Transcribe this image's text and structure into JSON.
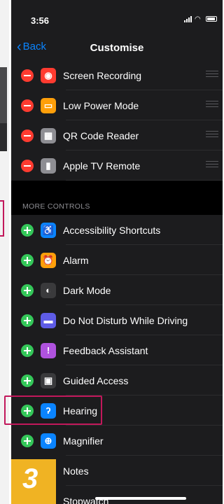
{
  "status_bar": {
    "time": "3:56"
  },
  "nav": {
    "back_label": "Back",
    "title": "Customise"
  },
  "included_controls": [
    {
      "label": "Screen Recording",
      "icon": "screen-recording-icon",
      "color": "#ff3b30"
    },
    {
      "label": "Low Power Mode",
      "icon": "battery-icon",
      "color": "#ff9f0a"
    },
    {
      "label": "QR Code Reader",
      "icon": "qr-code-icon",
      "color": "#8e8e93"
    },
    {
      "label": "Apple TV Remote",
      "icon": "remote-icon",
      "color": "#8e8e93"
    }
  ],
  "more_controls": {
    "header": "MORE CONTROLS",
    "items": [
      {
        "label": "Accessibility Shortcuts",
        "icon": "accessibility-icon",
        "color": "#0a84ff"
      },
      {
        "label": "Alarm",
        "icon": "alarm-icon",
        "color": "#ff9f0a"
      },
      {
        "label": "Dark Mode",
        "icon": "dark-mode-icon",
        "color": "#3a3a3c"
      },
      {
        "label": "Do Not Disturb While Driving",
        "icon": "car-icon",
        "color": "#5e5ce6"
      },
      {
        "label": "Feedback Assistant",
        "icon": "feedback-icon",
        "color": "#af52de"
      },
      {
        "label": "Guided Access",
        "icon": "lock-icon",
        "color": "#3a3a3c"
      },
      {
        "label": "Hearing",
        "icon": "ear-icon",
        "color": "#0a84ff"
      },
      {
        "label": "Magnifier",
        "icon": "magnifier-icon",
        "color": "#0a84ff"
      },
      {
        "label": "Notes",
        "icon": "notes-icon",
        "color": "#ffcc00"
      },
      {
        "label": "Stopwatch",
        "icon": "stopwatch-icon",
        "color": "#ff9f0a"
      }
    ]
  },
  "step_badge": "3",
  "colors": {
    "accent": "#0a84ff",
    "highlight": "#c2185b",
    "badge": "#f0b323"
  }
}
